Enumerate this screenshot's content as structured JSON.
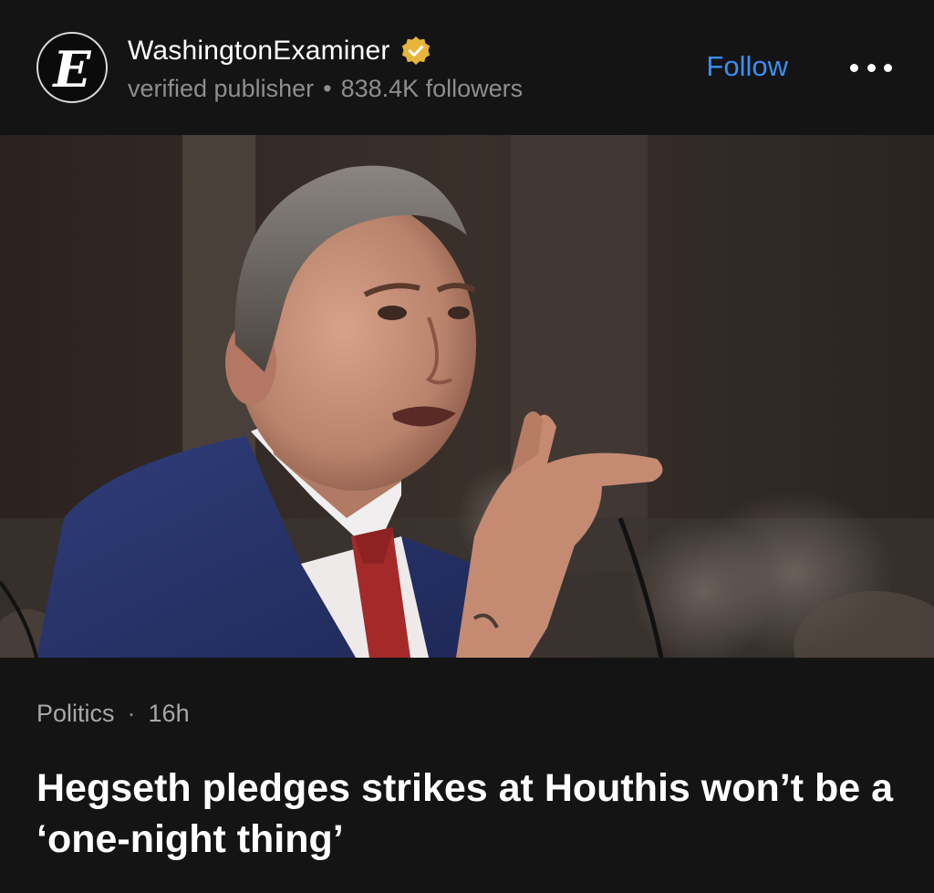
{
  "publisher": {
    "avatar_letter": "E",
    "name": "WashingtonExaminer",
    "status": "verified publisher",
    "separator": "•",
    "followers": "838.4K followers",
    "badge_color": "#e7b53c"
  },
  "actions": {
    "follow_label": "Follow",
    "follow_color": "#3c8ef3",
    "more_icon": "more-horizontal-icon"
  },
  "article": {
    "category": "Politics",
    "separator": "·",
    "age": "16h",
    "headline": "Hegseth pledges strikes at Houthis won’t be a ‘one-night thing’"
  },
  "theme": {
    "background": "#141414",
    "meta_text": "#8e8e8e"
  }
}
